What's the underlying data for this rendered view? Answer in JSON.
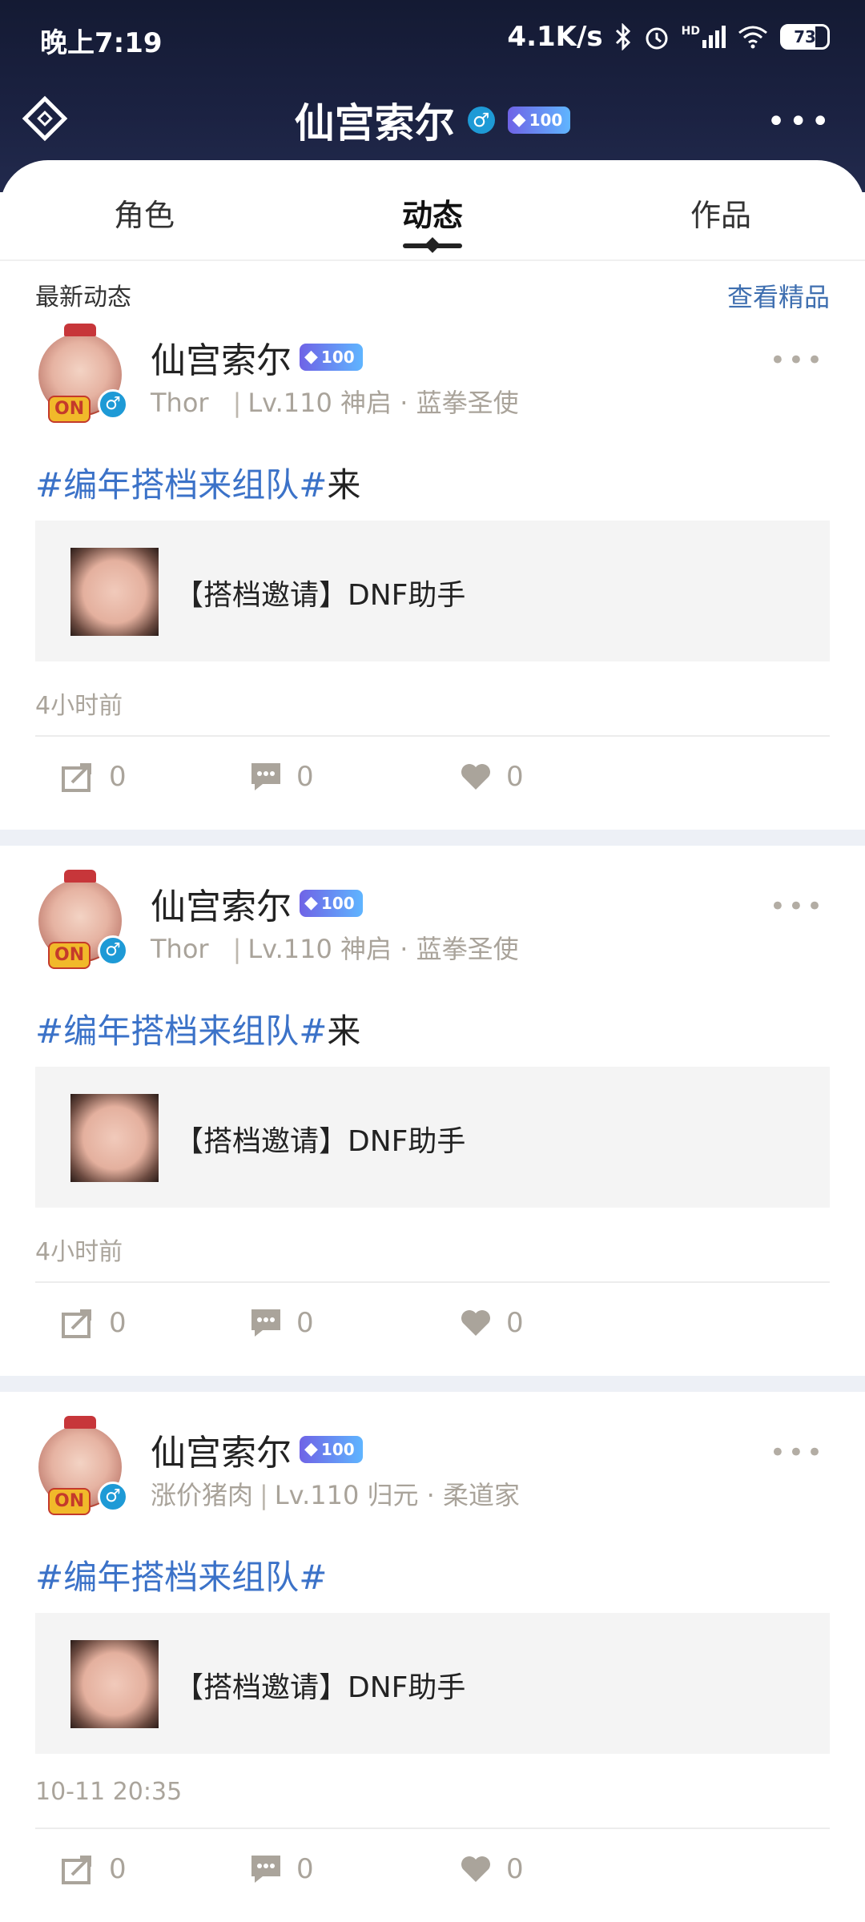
{
  "status_bar": {
    "time": "晚上7:19",
    "net_speed": "4.1K/s",
    "hd_label": "HD",
    "battery": "73"
  },
  "header": {
    "title": "仙宫索尔",
    "male_symbol": "♂",
    "vip_level": "100"
  },
  "tabs": [
    {
      "label": "角色"
    },
    {
      "label": "动态"
    },
    {
      "label": "作品"
    }
  ],
  "section": {
    "title": "最新动态",
    "link": "查看精品"
  },
  "posts": [
    {
      "name": "仙宫索尔",
      "vip_level": "100",
      "avatar_tag": "ON",
      "male_symbol": "♂",
      "nickname": "Thor",
      "level_info": "Lv.110 神启 · 蓝拳圣使",
      "hashtag": "#编年搭档来组队#",
      "text_suffix": "来",
      "card_title": "【搭档邀请】DNF助手",
      "time": "4小时前",
      "shares": "0",
      "comments": "0",
      "likes": "0"
    },
    {
      "name": "仙宫索尔",
      "vip_level": "100",
      "avatar_tag": "ON",
      "male_symbol": "♂",
      "nickname": "Thor",
      "level_info": "Lv.110 神启 · 蓝拳圣使",
      "hashtag": "#编年搭档来组队#",
      "text_suffix": "来",
      "card_title": "【搭档邀请】DNF助手",
      "time": "4小时前",
      "shares": "0",
      "comments": "0",
      "likes": "0"
    },
    {
      "name": "仙宫索尔",
      "vip_level": "100",
      "avatar_tag": "ON",
      "male_symbol": "♂",
      "nickname": "涨价猪肉",
      "level_info": "Lv.110 归元 · 柔道家",
      "hashtag": "#编年搭档来组队#",
      "text_suffix": "",
      "card_title": "【搭档邀请】DNF助手",
      "time": "10-11 20:35",
      "shares": "0",
      "comments": "0",
      "likes": "0"
    }
  ],
  "colors": {
    "header_bg": "#1b2242",
    "hashtag": "#3b72c8",
    "link": "#3f6fb0",
    "muted": "#aaa49b",
    "gap": "#edf0f6"
  }
}
